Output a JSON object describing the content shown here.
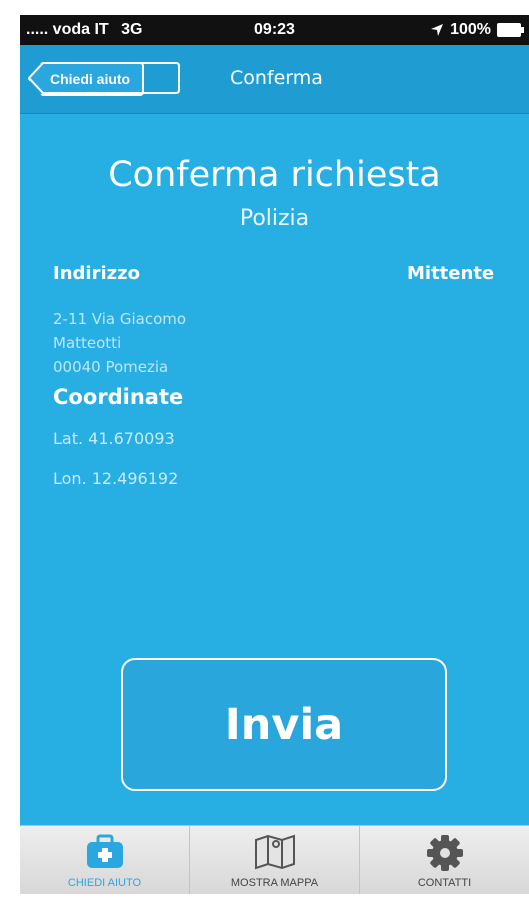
{
  "status_bar": {
    "carrier": "..... voda IT",
    "network": "3G",
    "time": "09:23",
    "battery": "100%"
  },
  "nav": {
    "back_label": "Chiedi aiuto",
    "title": "Conferma"
  },
  "content": {
    "title": "Conferma richiesta",
    "subtitle": "Polizia",
    "address_label": "Indirizzo",
    "sender_label": "Mittente",
    "address_lines": [
      "2-11 Via Giacomo",
      "Matteotti",
      "00040 Pomezia"
    ],
    "coordinates_label": "Coordinate",
    "lat": "Lat. 41.670093",
    "lon": "Lon. 12.496192"
  },
  "send_button": {
    "label": "Invia"
  },
  "tabs": [
    {
      "label": "CHIEDI AIUTO",
      "icon": "first-aid-kit-icon",
      "active": true
    },
    {
      "label": "MOSTRA MAPPA",
      "icon": "map-icon",
      "active": false
    },
    {
      "label": "CONTATTI",
      "icon": "gear-icon",
      "active": false
    }
  ],
  "colors": {
    "background": "#27aee3",
    "navbar": "#1f9dd3",
    "active_tab": "#2aa7de",
    "text": "#ffffff"
  }
}
